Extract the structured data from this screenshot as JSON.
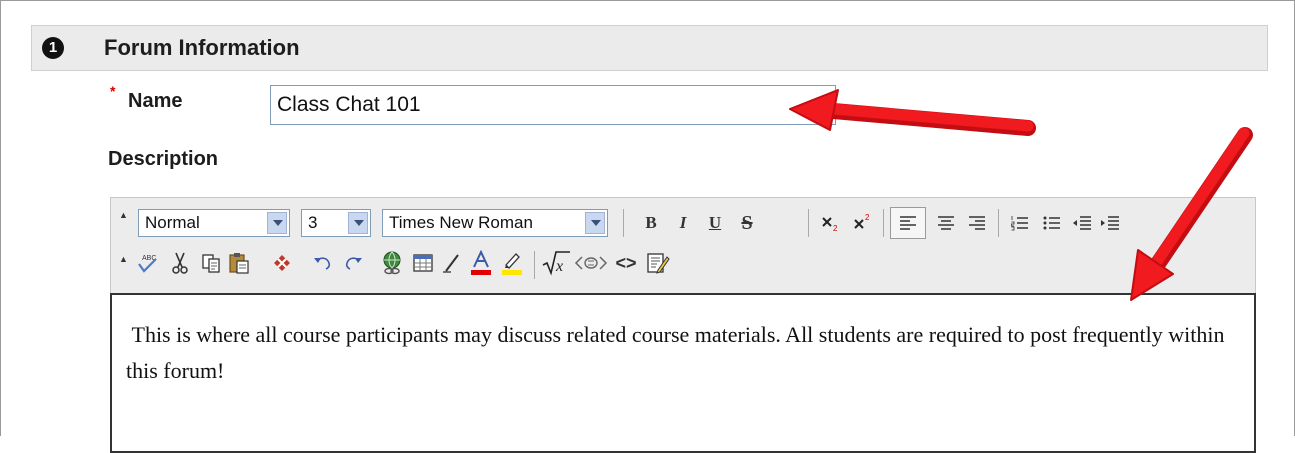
{
  "section": {
    "step_number": "1",
    "title": "Forum Information"
  },
  "name_field": {
    "required_marker": "*",
    "label": "Name",
    "value": "Class Chat 101"
  },
  "description": {
    "label": "Description",
    "toolbar": {
      "format_select": "Normal",
      "size_select": "3",
      "font_select": "Times New Roman",
      "bold": "B",
      "italic": "I",
      "underline": "U",
      "strike": "S",
      "code": "<>"
    },
    "content": " This is where all course participants may discuss related course materials. All students are required to post frequently within this forum!"
  },
  "colors": {
    "arrow": "#e8151a",
    "section_bg": "#ebebeb",
    "input_border": "#7f9db9",
    "required": "#d40000"
  }
}
